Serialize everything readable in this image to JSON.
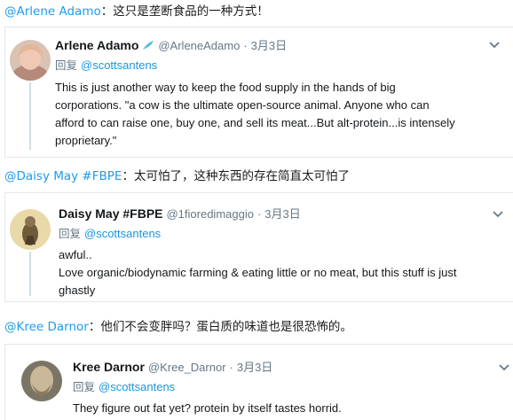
{
  "captions": [
    {
      "handle": "@Arlene Adamo",
      "sep": "：",
      "text": "这只是垄断食品的一种方式！"
    },
    {
      "handle": "@Daisy May #FBPE",
      "sep": "：",
      "text": "太可怕了，这种东西的存在简直太可怕了"
    },
    {
      "handle": "@Kree Darnor",
      "sep": "：",
      "text": "他们不会变胖吗？蛋白质的味道也是很恐怖的。"
    }
  ],
  "tweets": [
    {
      "name": "Arlene Adamo",
      "username": "@ArleneAdamo",
      "dot": "·",
      "date": "3月3日",
      "reply_prefix": "回复",
      "reply_to": "@scottsantens",
      "lines": [
        "This is just another way to keep the food supply in the hands of big",
        "corporations. \"a cow is the ultimate open-source  animal. Anyone who can",
        "afford to can raise one, buy one, and sell its meat...But alt-protein...is intensely",
        "proprietary.\""
      ]
    },
    {
      "name": "Daisy May #FBPE",
      "username": "@1fioredimaggio",
      "dot": "·",
      "date": "3月3日",
      "reply_prefix": "回复",
      "reply_to": "@scottsantens",
      "lines": [
        "awful..",
        "Love organic/biodynamic farming & eating little or no meat, but this stuff is just",
        "ghastly"
      ]
    },
    {
      "name": "Kree Darnor",
      "username": "@Kree_Darnor",
      "dot": "·",
      "date": "3月3日",
      "reply_prefix": "回复",
      "reply_to": "@scottsantens",
      "lines": [
        "They figure out fat yet? protein by itself tastes horrid."
      ]
    }
  ],
  "colors": {
    "link": "#1d9bf0",
    "muted": "#657786",
    "border": "#e1e8ed"
  },
  "icons": {
    "menu": "chevron-down-icon",
    "badge": "feather-icon"
  }
}
